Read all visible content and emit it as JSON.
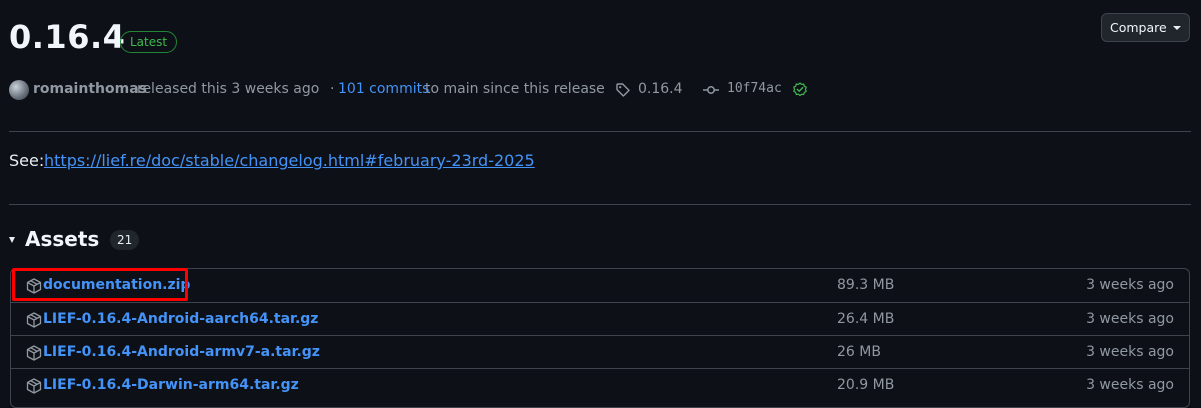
{
  "release": {
    "version": "0.16.4",
    "badge": "Latest",
    "compare_label": "Compare",
    "author": "romainthomas",
    "released_text": "released this 3 weeks ago",
    "separator": "·",
    "commits_link": "101 commits",
    "commits_rest": "to main since this release",
    "tag": "0.16.4",
    "commit_sha": "10f74ac"
  },
  "notes": {
    "see_label": "See:",
    "link": "https://lief.re/doc/stable/changelog.html#february-23rd-2025"
  },
  "assets": {
    "title": "Assets",
    "count": "21",
    "items": [
      {
        "name": "documentation.zip",
        "size": "89.3 MB",
        "date": "3 weeks ago"
      },
      {
        "name": "LIEF-0.16.4-Android-aarch64.tar.gz",
        "size": "26.4 MB",
        "date": "3 weeks ago"
      },
      {
        "name": "LIEF-0.16.4-Android-armv7-a.tar.gz",
        "size": "26 MB",
        "date": "3 weeks ago"
      },
      {
        "name": "LIEF-0.16.4-Darwin-arm64.tar.gz",
        "size": "20.9 MB",
        "date": "3 weeks ago"
      }
    ]
  },
  "colors": {
    "background": "#0d1117",
    "link": "#4493f8",
    "latest_badge": "#3fb950",
    "highlight": "#ff0000"
  },
  "icons": [
    "tag-icon",
    "git-commit-icon",
    "verified-check-icon",
    "package-icon",
    "caret-down-icon"
  ]
}
